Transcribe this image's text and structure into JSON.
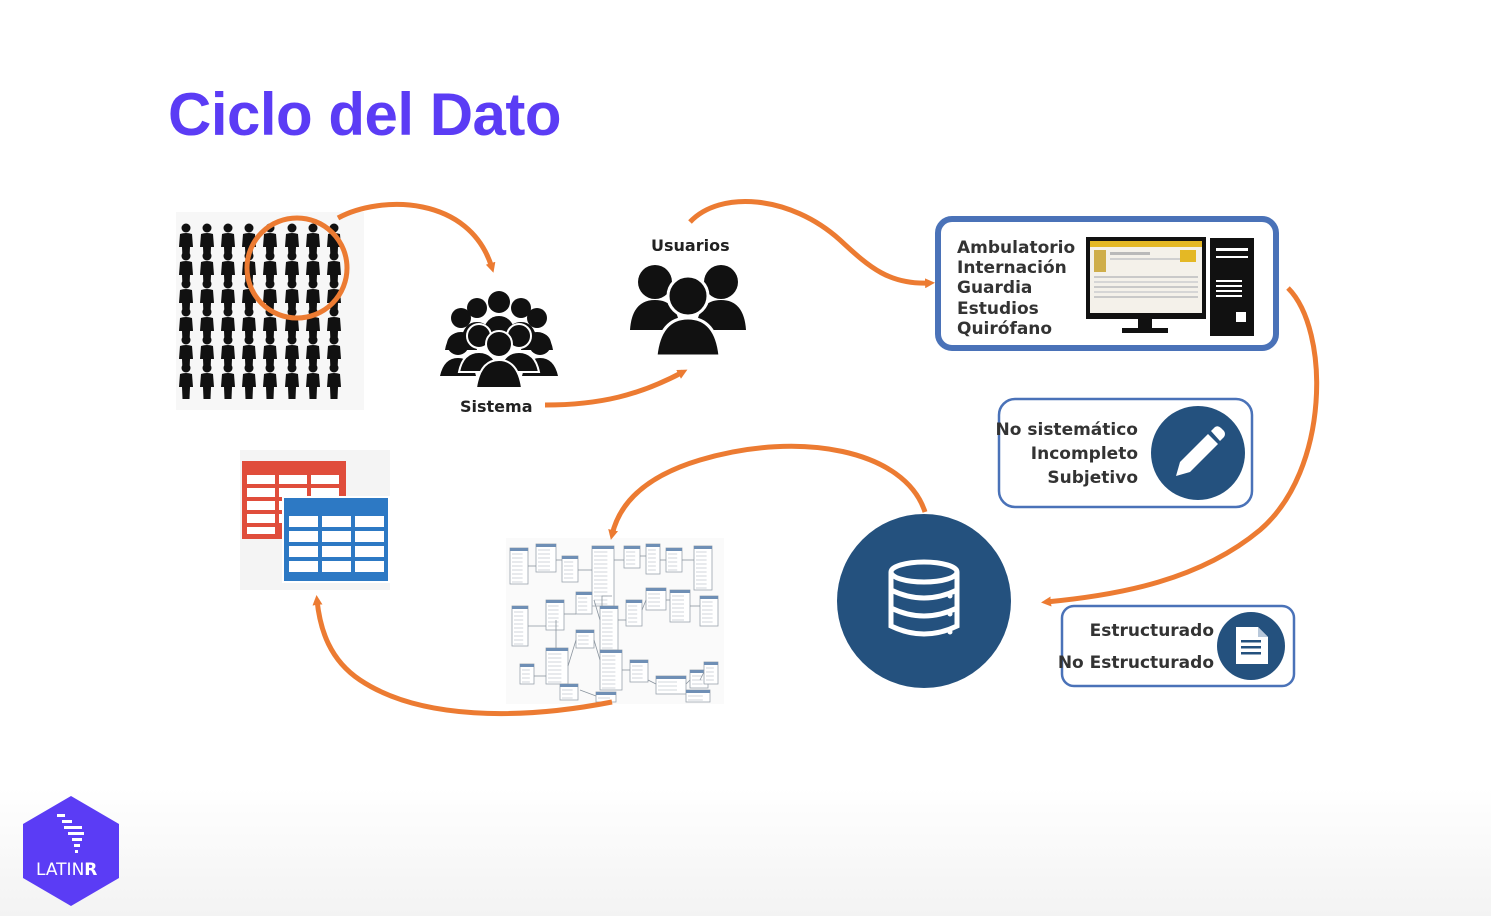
{
  "title": "Ciclo del Dato",
  "labels": {
    "sistema": "Sistema",
    "usuarios": "Usuarios"
  },
  "modules": [
    "Ambulatorio",
    "Internación",
    "Guardia",
    "Estudios",
    "Quirófano"
  ],
  "quality": [
    "No sistemático",
    "Incompleto",
    "Subjetivo"
  ],
  "data_types": [
    "Estructurado",
    "No Estructurado"
  ],
  "logo": {
    "text_a": "LATIN",
    "text_b": "R"
  },
  "colors": {
    "title": "#5b3cf5",
    "arrow": "#ec7b32",
    "navy": "#24517e",
    "box_border": "#4a72b8",
    "table_red": "#e04d3b",
    "table_blue": "#2d79c4",
    "logo": "#5b3cf5"
  },
  "icons": [
    "crowd-icon",
    "group-icon",
    "users-icon",
    "monitor-icon",
    "tower-pc-icon",
    "pencil-icon",
    "database-icon",
    "document-icon",
    "spreadsheet-icon",
    "schema-diagram"
  ]
}
